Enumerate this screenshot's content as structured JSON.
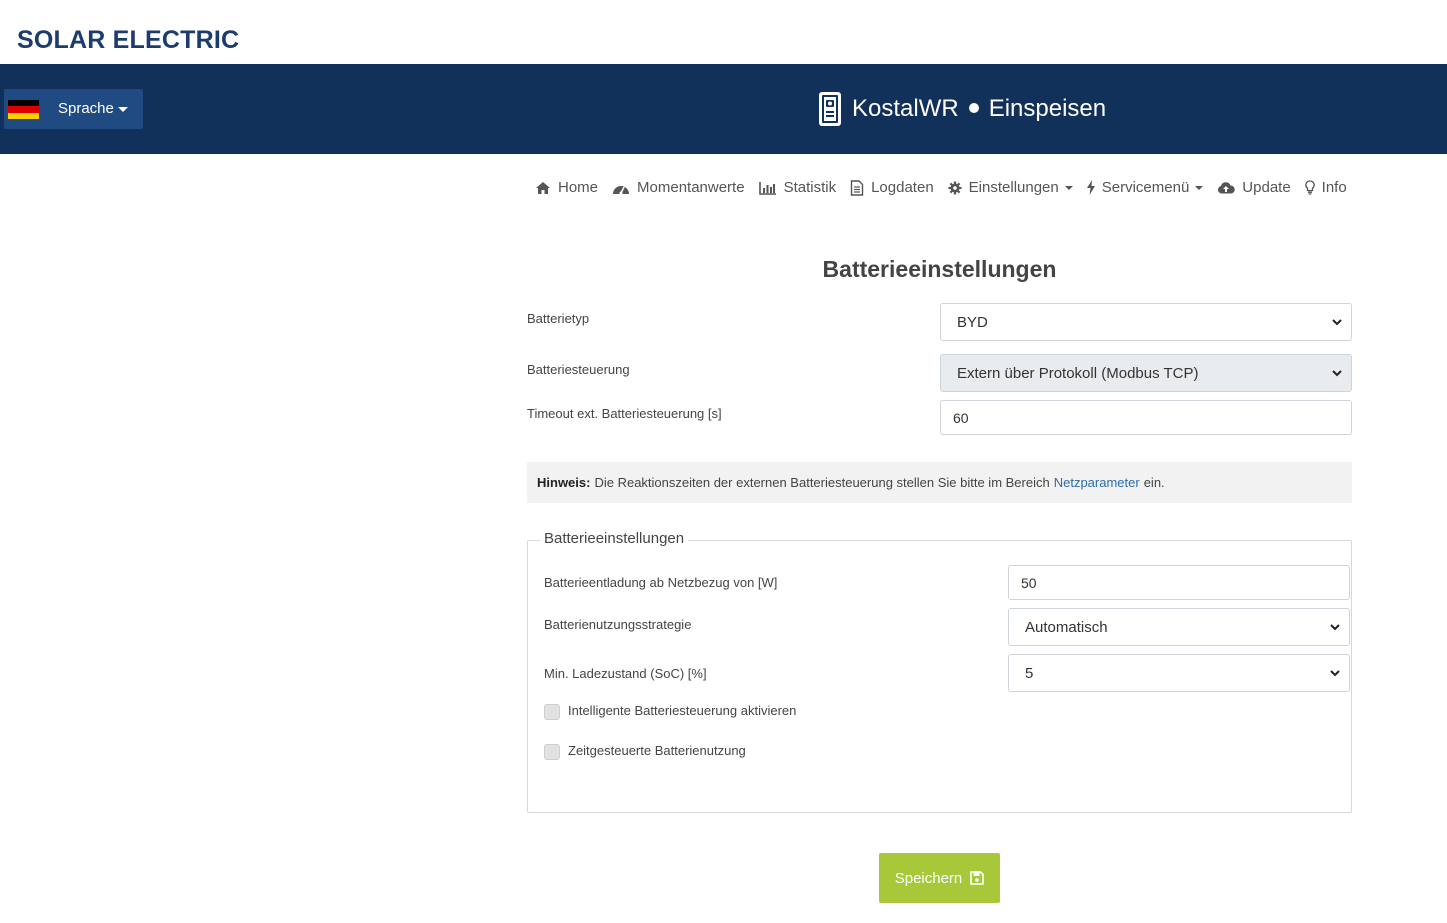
{
  "brand": {
    "name": "SOLAR ELECTRIC"
  },
  "header": {
    "language_label": "Sprache",
    "device_name": "KostalWR",
    "mode": "Einspeisen",
    "colors": {
      "bar": "#11305a",
      "lang_button": "#1f4a82"
    }
  },
  "nav": {
    "items": [
      {
        "label": "Home",
        "icon": "home-icon"
      },
      {
        "label": "Momentanwerte",
        "icon": "dashboard-icon"
      },
      {
        "label": "Statistik",
        "icon": "bar-chart-icon"
      },
      {
        "label": "Logdaten",
        "icon": "document-icon"
      },
      {
        "label": "Einstellungen",
        "icon": "gear-icon",
        "dropdown": true
      },
      {
        "label": "Servicemenü",
        "icon": "bolt-icon",
        "dropdown": true
      },
      {
        "label": "Update",
        "icon": "cloud-upload-icon"
      },
      {
        "label": "Info",
        "icon": "lightbulb-icon"
      }
    ]
  },
  "main": {
    "title": "Batterieeinstellungen",
    "fields": {
      "battery_type": {
        "label": "Batterietyp",
        "value": "BYD"
      },
      "battery_control": {
        "label": "Batteriesteuerung",
        "value": "Extern über Protokoll (Modbus TCP)"
      },
      "timeout": {
        "label": "Timeout ext. Batteriesteuerung [s]",
        "value": "60"
      }
    },
    "hint": {
      "prefix": "Hinweis:",
      "text": "Die Reaktionszeiten der externen Batteriesteuerung stellen Sie bitte im Bereich",
      "link": "Netzparameter",
      "suffix": "ein."
    },
    "fieldset": {
      "legend": "Batterieeinstellungen",
      "discharge": {
        "label": "Batterieentladung ab Netzbezug von [W]",
        "value": "50"
      },
      "strategy": {
        "label": "Batterienutzungsstrategie",
        "value": "Automatisch"
      },
      "min_soc": {
        "label": "Min. Ladezustand (SoC) [%]",
        "value": "5"
      },
      "smart_control": {
        "label": "Intelligente Batteriesteuerung aktivieren",
        "checked": false
      },
      "timed_usage": {
        "label": "Zeitgesteuerte Batterienutzung",
        "checked": false
      }
    },
    "save_label": "Speichern",
    "save_color": "#a8c83a"
  }
}
